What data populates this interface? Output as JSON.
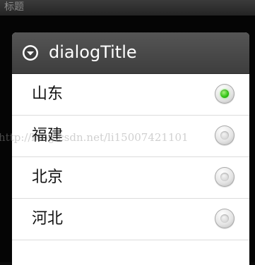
{
  "app": {
    "title": "标题",
    "background_label": "标题"
  },
  "dialog": {
    "title": "dialogTitle",
    "icon": "chevron-down-circle-icon",
    "options": [
      {
        "label": "山东",
        "checked": true
      },
      {
        "label": "福建",
        "checked": false
      },
      {
        "label": "北京",
        "checked": false
      },
      {
        "label": "河北",
        "checked": false
      }
    ]
  },
  "watermark": "http://blog.csdn.net/li15007421101",
  "colors": {
    "header_bg": "#4a4a4a",
    "selected_radio": "#2ec212",
    "divider": "#dcdcdc"
  }
}
